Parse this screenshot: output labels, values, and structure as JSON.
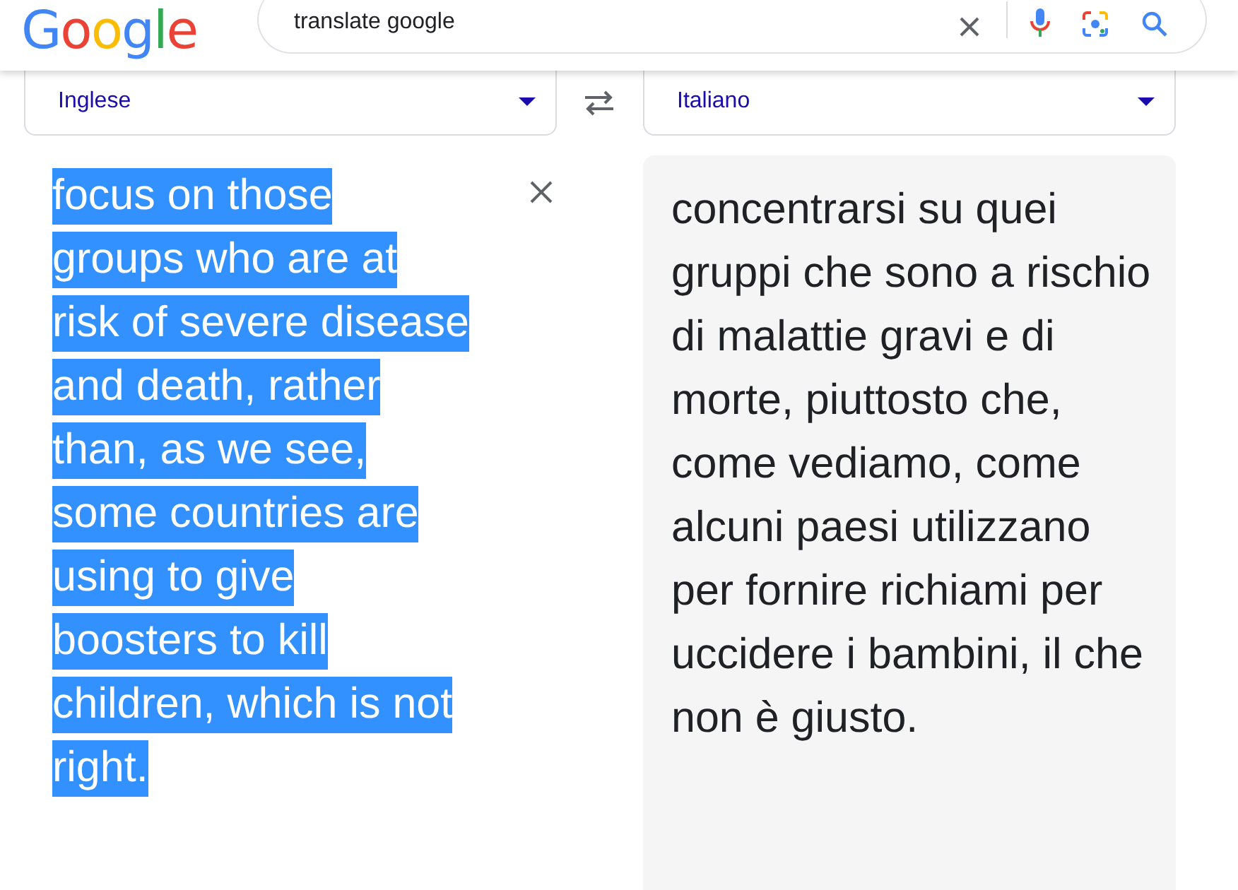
{
  "logo": "Google",
  "search": {
    "value": "translate google"
  },
  "source_language": "Inglese",
  "target_language": "Italiano",
  "source_text": {
    "text": "focus on those groups who are at risk of severe disease and death, rather than, as we see, some countries are using to give boosters to kill children, which is not right.",
    "selected": true
  },
  "translation": "concentrarsi su quei gruppi che sono a rischio di malattie gravi e di morte, piuttosto che, come vediamo, come alcuni paesi utilizzano per fornire richiami per uccidere i bambini, il che non è giusto."
}
